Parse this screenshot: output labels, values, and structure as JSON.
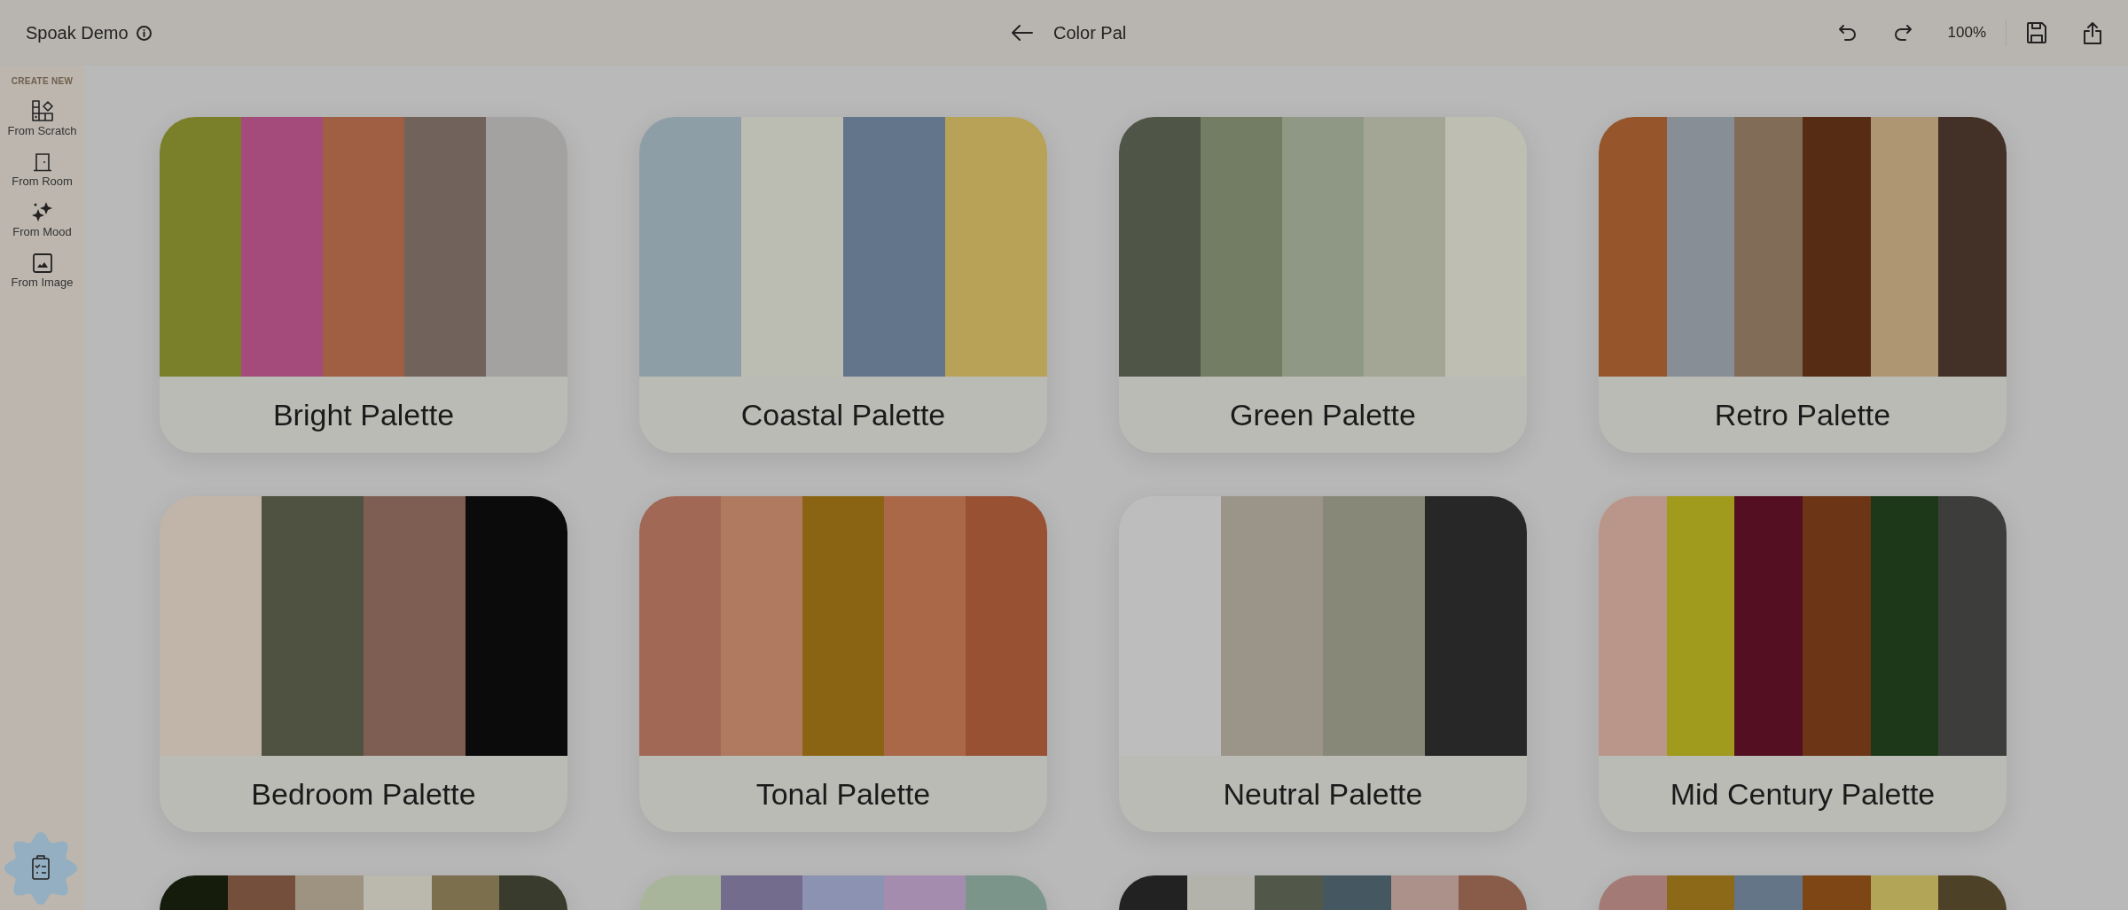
{
  "header": {
    "workspace": "Spoak Demo",
    "title": "Color Pal",
    "zoom": "100%"
  },
  "sidebar": {
    "heading": "CREATE NEW",
    "items": [
      {
        "label": "From Scratch",
        "kind": "scratch"
      },
      {
        "label": "From Room",
        "kind": "room"
      },
      {
        "label": "From Mood",
        "kind": "mood"
      },
      {
        "label": "From Image",
        "kind": "image"
      }
    ]
  },
  "palettes": [
    {
      "name": "Bright Palette",
      "swatches": [
        {
          "color": "#7a8029"
        },
        {
          "color": "#a54b7c"
        },
        {
          "color": "#a05e43"
        },
        {
          "color": "#72625c"
        },
        {
          "color": "#a3a2a0"
        }
      ]
    },
    {
      "name": "Coastal Palette",
      "swatches": [
        {
          "color": "#8e9ea6"
        },
        {
          "color": "#bcbdb2"
        },
        {
          "color": "#63758b"
        },
        {
          "color": "#b8a258"
        }
      ]
    },
    {
      "name": "Green Palette",
      "swatches": [
        {
          "color": "#4f5547"
        },
        {
          "color": "#727d64"
        },
        {
          "color": "#8f9884"
        },
        {
          "color": "#a4a695"
        },
        {
          "color": "#bebfb2"
        }
      ]
    },
    {
      "name": "Retro Palette",
      "swatches": [
        {
          "color": "#96552b"
        },
        {
          "color": "#878e95"
        },
        {
          "color": "#816c57"
        },
        {
          "color": "#562c15"
        },
        {
          "color": "#ae9673"
        },
        {
          "color": "#433026"
        }
      ]
    },
    {
      "name": "Bedroom Palette",
      "swatches": [
        {
          "color": "#c0b5a8"
        },
        {
          "color": "#4f5141"
        },
        {
          "color": "#7e5e52"
        },
        {
          "color": "#0b0b0b"
        }
      ]
    },
    {
      "name": "Tonal Palette",
      "swatches": [
        {
          "color": "#a26856"
        },
        {
          "color": "#af7a5f"
        },
        {
          "color": "#8a6413"
        },
        {
          "color": "#ab6848"
        },
        {
          "color": "#985133"
        }
      ]
    },
    {
      "name": "Neutral Palette",
      "swatches": [
        {
          "color": "#bdbdbd"
        },
        {
          "color": "#9b9489"
        },
        {
          "color": "#888878"
        },
        {
          "color": "#272727"
        }
      ]
    },
    {
      "name": "Mid Century Palette",
      "swatches": [
        {
          "color": "#ba968a"
        },
        {
          "color": "#a09a1d"
        },
        {
          "color": "#540f22"
        },
        {
          "color": "#6c3515"
        },
        {
          "color": "#1c3819"
        },
        {
          "color": "#3d3e3c"
        }
      ]
    },
    {
      "swatches": [
        {
          "color": "#161c0c"
        },
        {
          "color": "#744f3b"
        },
        {
          "color": "#9e9281"
        },
        {
          "color": "#bbb9ae"
        },
        {
          "color": "#7b6f4e"
        },
        {
          "color": "#393b2c"
        }
      ]
    },
    {
      "swatches": [
        {
          "color": "#a8b59b"
        },
        {
          "color": "#736c8c"
        },
        {
          "color": "#8b92b2"
        },
        {
          "color": "#a48caf"
        },
        {
          "color": "#7c958a"
        }
      ]
    },
    {
      "swatches": [
        {
          "color": "#222222"
        },
        {
          "color": "#b3b3ac"
        },
        {
          "color": "#525849"
        },
        {
          "color": "#455761"
        },
        {
          "color": "#ab9189"
        },
        {
          "color": "#895c49"
        }
      ]
    },
    {
      "swatches": [
        {
          "color": "#a37a76"
        },
        {
          "color": "#8b6919"
        },
        {
          "color": "#637587"
        },
        {
          "color": "#7e4515"
        },
        {
          "color": "#b3a558"
        },
        {
          "color": "#4d4228"
        }
      ]
    }
  ]
}
